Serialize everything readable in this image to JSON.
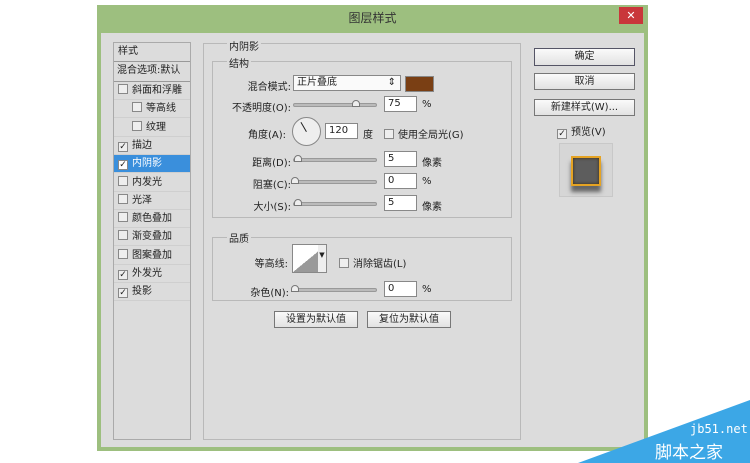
{
  "window": {
    "title": "图层样式",
    "close_icon": "close-icon"
  },
  "styles_list": {
    "header": "样式",
    "blend": "混合选项:默认",
    "items": [
      {
        "label": "斜面和浮雕",
        "checked": false
      },
      {
        "label": "等高线",
        "checked": false
      },
      {
        "label": "纹理",
        "checked": false
      },
      {
        "label": "描边",
        "checked": true
      },
      {
        "label": "内阴影",
        "checked": true,
        "selected": true
      },
      {
        "label": "内发光",
        "checked": false
      },
      {
        "label": "光泽",
        "checked": false
      },
      {
        "label": "颜色叠加",
        "checked": false
      },
      {
        "label": "渐变叠加",
        "checked": false
      },
      {
        "label": "图案叠加",
        "checked": false
      },
      {
        "label": "外发光",
        "checked": true
      },
      {
        "label": "投影",
        "checked": true
      }
    ]
  },
  "inner_shadow": {
    "title": "内阴影",
    "structure": {
      "title": "结构",
      "blend_mode_label": "混合模式:",
      "blend_mode": "正片叠底",
      "color": "#7a3f14",
      "opacity_label": "不透明度(O):",
      "opacity": "75",
      "opacity_unit": "%",
      "angle_label": "角度(A):",
      "angle": "120",
      "angle_unit": "度",
      "global_light": "使用全局光(G)",
      "global_light_checked": false,
      "distance_label": "距离(D):",
      "distance": "5",
      "distance_unit": "像素",
      "choke_label": "阻塞(C):",
      "choke": "0",
      "choke_unit": "%",
      "size_label": "大小(S):",
      "size": "5",
      "size_unit": "像素"
    },
    "quality": {
      "title": "品质",
      "contour_label": "等高线:",
      "antialias": "消除锯齿(L)",
      "antialias_checked": false,
      "noise_label": "杂色(N):",
      "noise": "0",
      "noise_unit": "%"
    },
    "set_default": "设置为默认值",
    "reset_default": "复位为默认值"
  },
  "right": {
    "ok": "确定",
    "cancel": "取消",
    "new_style": "新建样式(W)...",
    "preview": "预览(V)",
    "preview_checked": true
  },
  "watermark": {
    "site": "jb51.net",
    "name": "脚本之家"
  }
}
